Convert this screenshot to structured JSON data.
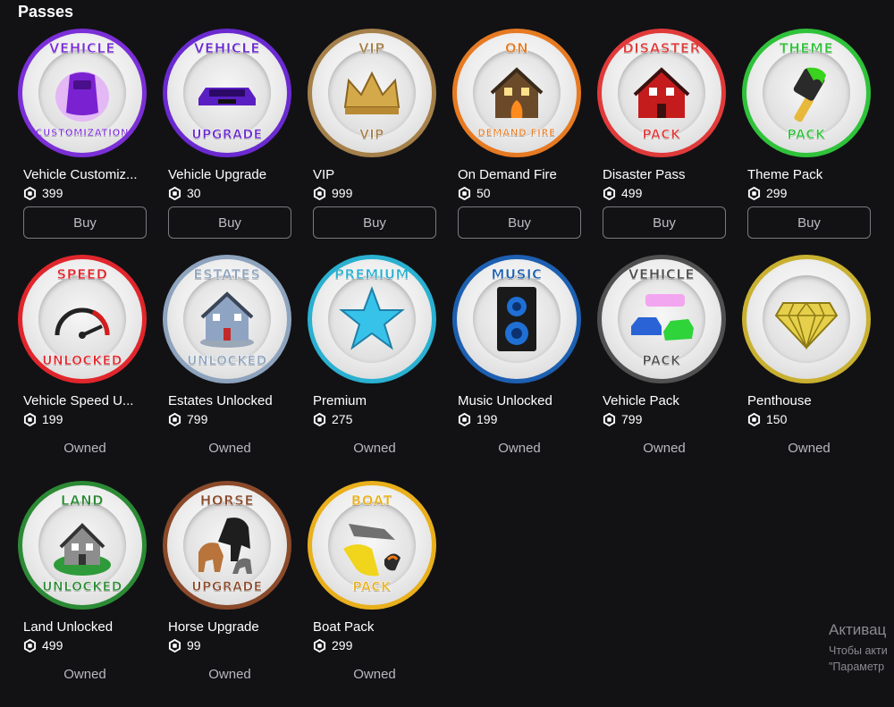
{
  "section": {
    "title": "Passes"
  },
  "actions": {
    "buy_label": "Buy"
  },
  "passes": [
    {
      "name": "Vehicle Customiz...",
      "price": "399",
      "status": "buy",
      "badge_top": "VEHICLE",
      "badge_bottom": "CUSTOMIZATION",
      "accent": "#7b2fd6",
      "art": "car-purple-icon"
    },
    {
      "name": "Vehicle Upgrade",
      "price": "30",
      "status": "buy",
      "badge_top": "VEHICLE",
      "badge_bottom": "UPGRADE",
      "accent": "#6a2ad0",
      "art": "car-upgrade-icon"
    },
    {
      "name": "VIP",
      "price": "999",
      "status": "buy",
      "badge_top": "VIP",
      "badge_bottom": "VIP",
      "accent": "#a5804a",
      "art": "crown-icon"
    },
    {
      "name": "On Demand Fire",
      "price": "50",
      "status": "buy",
      "badge_top": "ON",
      "badge_bottom": "DEMAND FIRE",
      "accent": "#e67a22",
      "art": "house-fire-icon"
    },
    {
      "name": "Disaster Pass",
      "price": "499",
      "status": "buy",
      "badge_top": "DISASTER",
      "badge_bottom": "PACK",
      "accent": "#e03a3a",
      "art": "house-red-icon"
    },
    {
      "name": "Theme Pack",
      "price": "299",
      "status": "buy",
      "badge_top": "THEME",
      "badge_bottom": "PACK",
      "accent": "#2fc23a",
      "art": "paintbrush-icon"
    },
    {
      "name": "Vehicle Speed U...",
      "price": "199",
      "status": "owned",
      "status_label": "Owned",
      "badge_top": "SPEED",
      "badge_bottom": "UNLOCKED",
      "accent": "#e0262c",
      "art": "speedometer-icon"
    },
    {
      "name": "Estates Unlocked",
      "price": "799",
      "status": "owned",
      "status_label": "Owned",
      "badge_top": "ESTATES",
      "badge_bottom": "UNLOCKED",
      "accent": "#8ea3bd",
      "art": "estate-house-icon"
    },
    {
      "name": "Premium",
      "price": "275",
      "status": "owned",
      "status_label": "Owned",
      "badge_top": "PREMIUM",
      "badge_bottom": "",
      "accent": "#2ab0d0",
      "art": "star-icon"
    },
    {
      "name": "Music Unlocked",
      "price": "199",
      "status": "owned",
      "status_label": "Owned",
      "badge_top": "MUSIC",
      "badge_bottom": "",
      "accent": "#1d5fb0",
      "art": "speaker-icon"
    },
    {
      "name": "Vehicle Pack",
      "price": "799",
      "status": "owned",
      "status_label": "Owned",
      "badge_top": "VEHICLE",
      "badge_bottom": "PACK",
      "accent": "#505050",
      "art": "vehicles-icon"
    },
    {
      "name": "Penthouse",
      "price": "150",
      "status": "owned",
      "status_label": "Owned",
      "badge_top": "",
      "badge_bottom": "",
      "accent": "#c9b030",
      "art": "diamond-icon"
    },
    {
      "name": "Land Unlocked",
      "price": "499",
      "status": "owned",
      "status_label": "Owned",
      "badge_top": "LAND",
      "badge_bottom": "UNLOCKED",
      "accent": "#2c8a35",
      "art": "land-house-icon"
    },
    {
      "name": "Horse Upgrade",
      "price": "99",
      "status": "owned",
      "status_label": "Owned",
      "badge_top": "HORSE",
      "badge_bottom": "UPGRADE",
      "accent": "#8a4a2a",
      "art": "horse-icon"
    },
    {
      "name": "Boat Pack",
      "price": "299",
      "status": "owned",
      "status_label": "Owned",
      "badge_top": "BOAT",
      "badge_bottom": "PACK",
      "accent": "#e9b01c",
      "art": "boat-icon"
    }
  ],
  "watermark": {
    "line1": "Активац",
    "line2": "Чтобы акти",
    "line3": "\"Параметр"
  }
}
